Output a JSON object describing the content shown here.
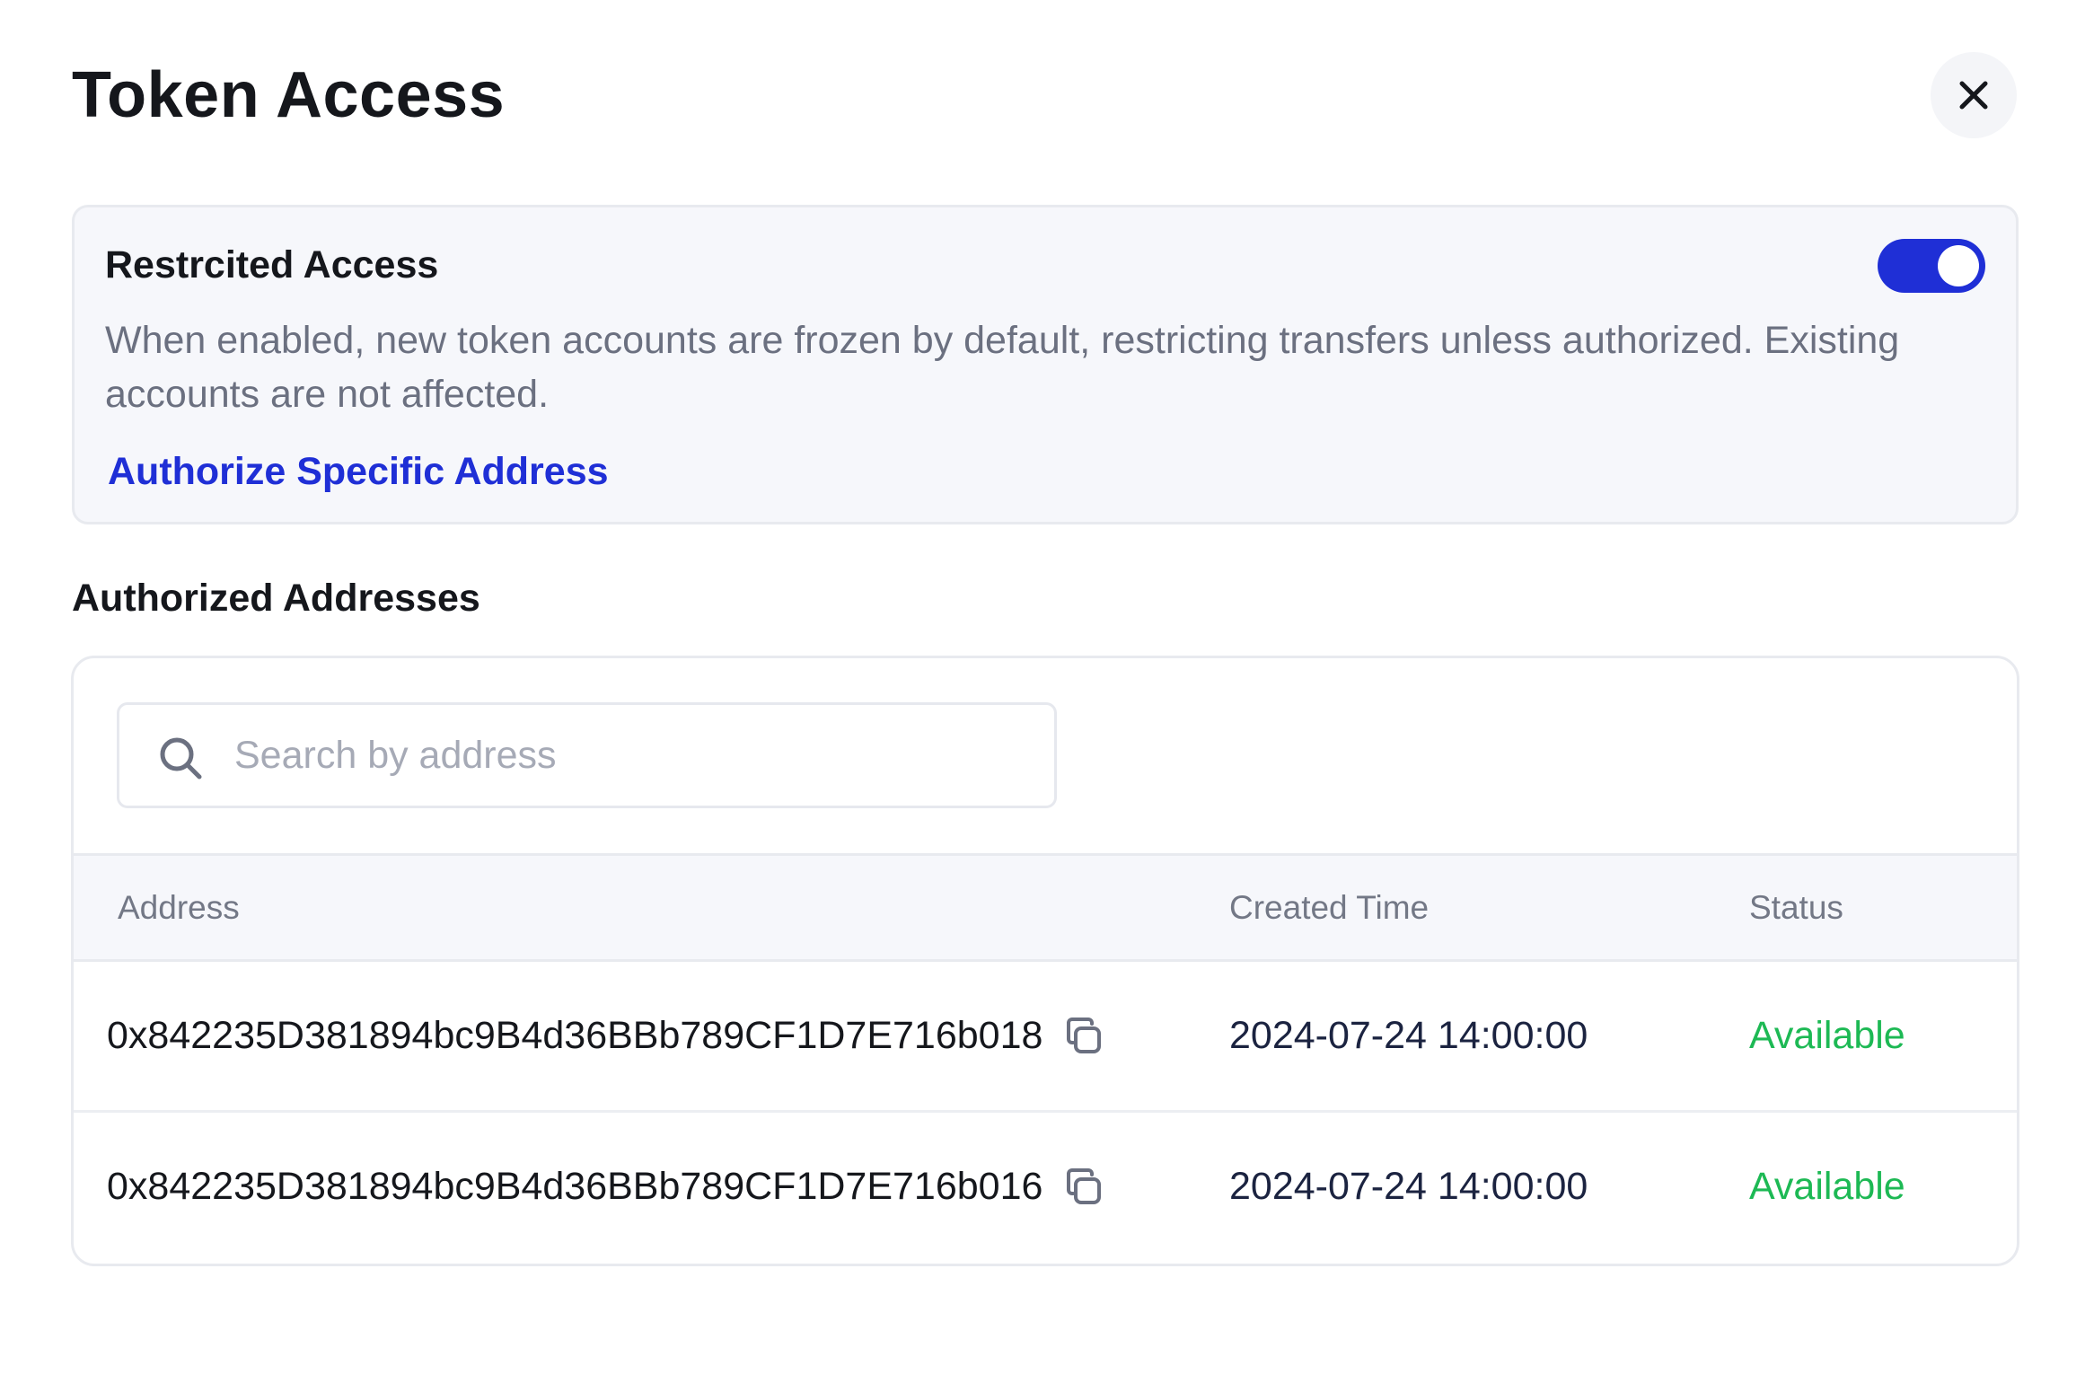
{
  "modal": {
    "title": "Token Access",
    "close_icon": "close-icon"
  },
  "restricted": {
    "title": "Restrcited Access",
    "enabled": true,
    "toggle_color": "#1f2fd6",
    "description": "When enabled, new token accounts are frozen by default, restricting transfers unless authorized. Existing accounts are not affected.",
    "authorize_link": "Authorize Specific Address"
  },
  "authorized": {
    "title": "Authorized Addresses",
    "search": {
      "placeholder": "Search by address",
      "value": "",
      "icon": "search-icon"
    },
    "columns": [
      "Address",
      "Created Time",
      "Status"
    ],
    "rows": [
      {
        "address": "0x842235D381894bc9B4d36BBb789CF1D7E716b018",
        "created_time": "2024-07-24 14:00:00",
        "status": "Available"
      },
      {
        "address": "0x842235D381894bc9B4d36BBb789CF1D7E716b016",
        "created_time": "2024-07-24 14:00:00",
        "status": "Available"
      }
    ],
    "status_color": "#1db954",
    "copy_icon": "copy-icon"
  }
}
